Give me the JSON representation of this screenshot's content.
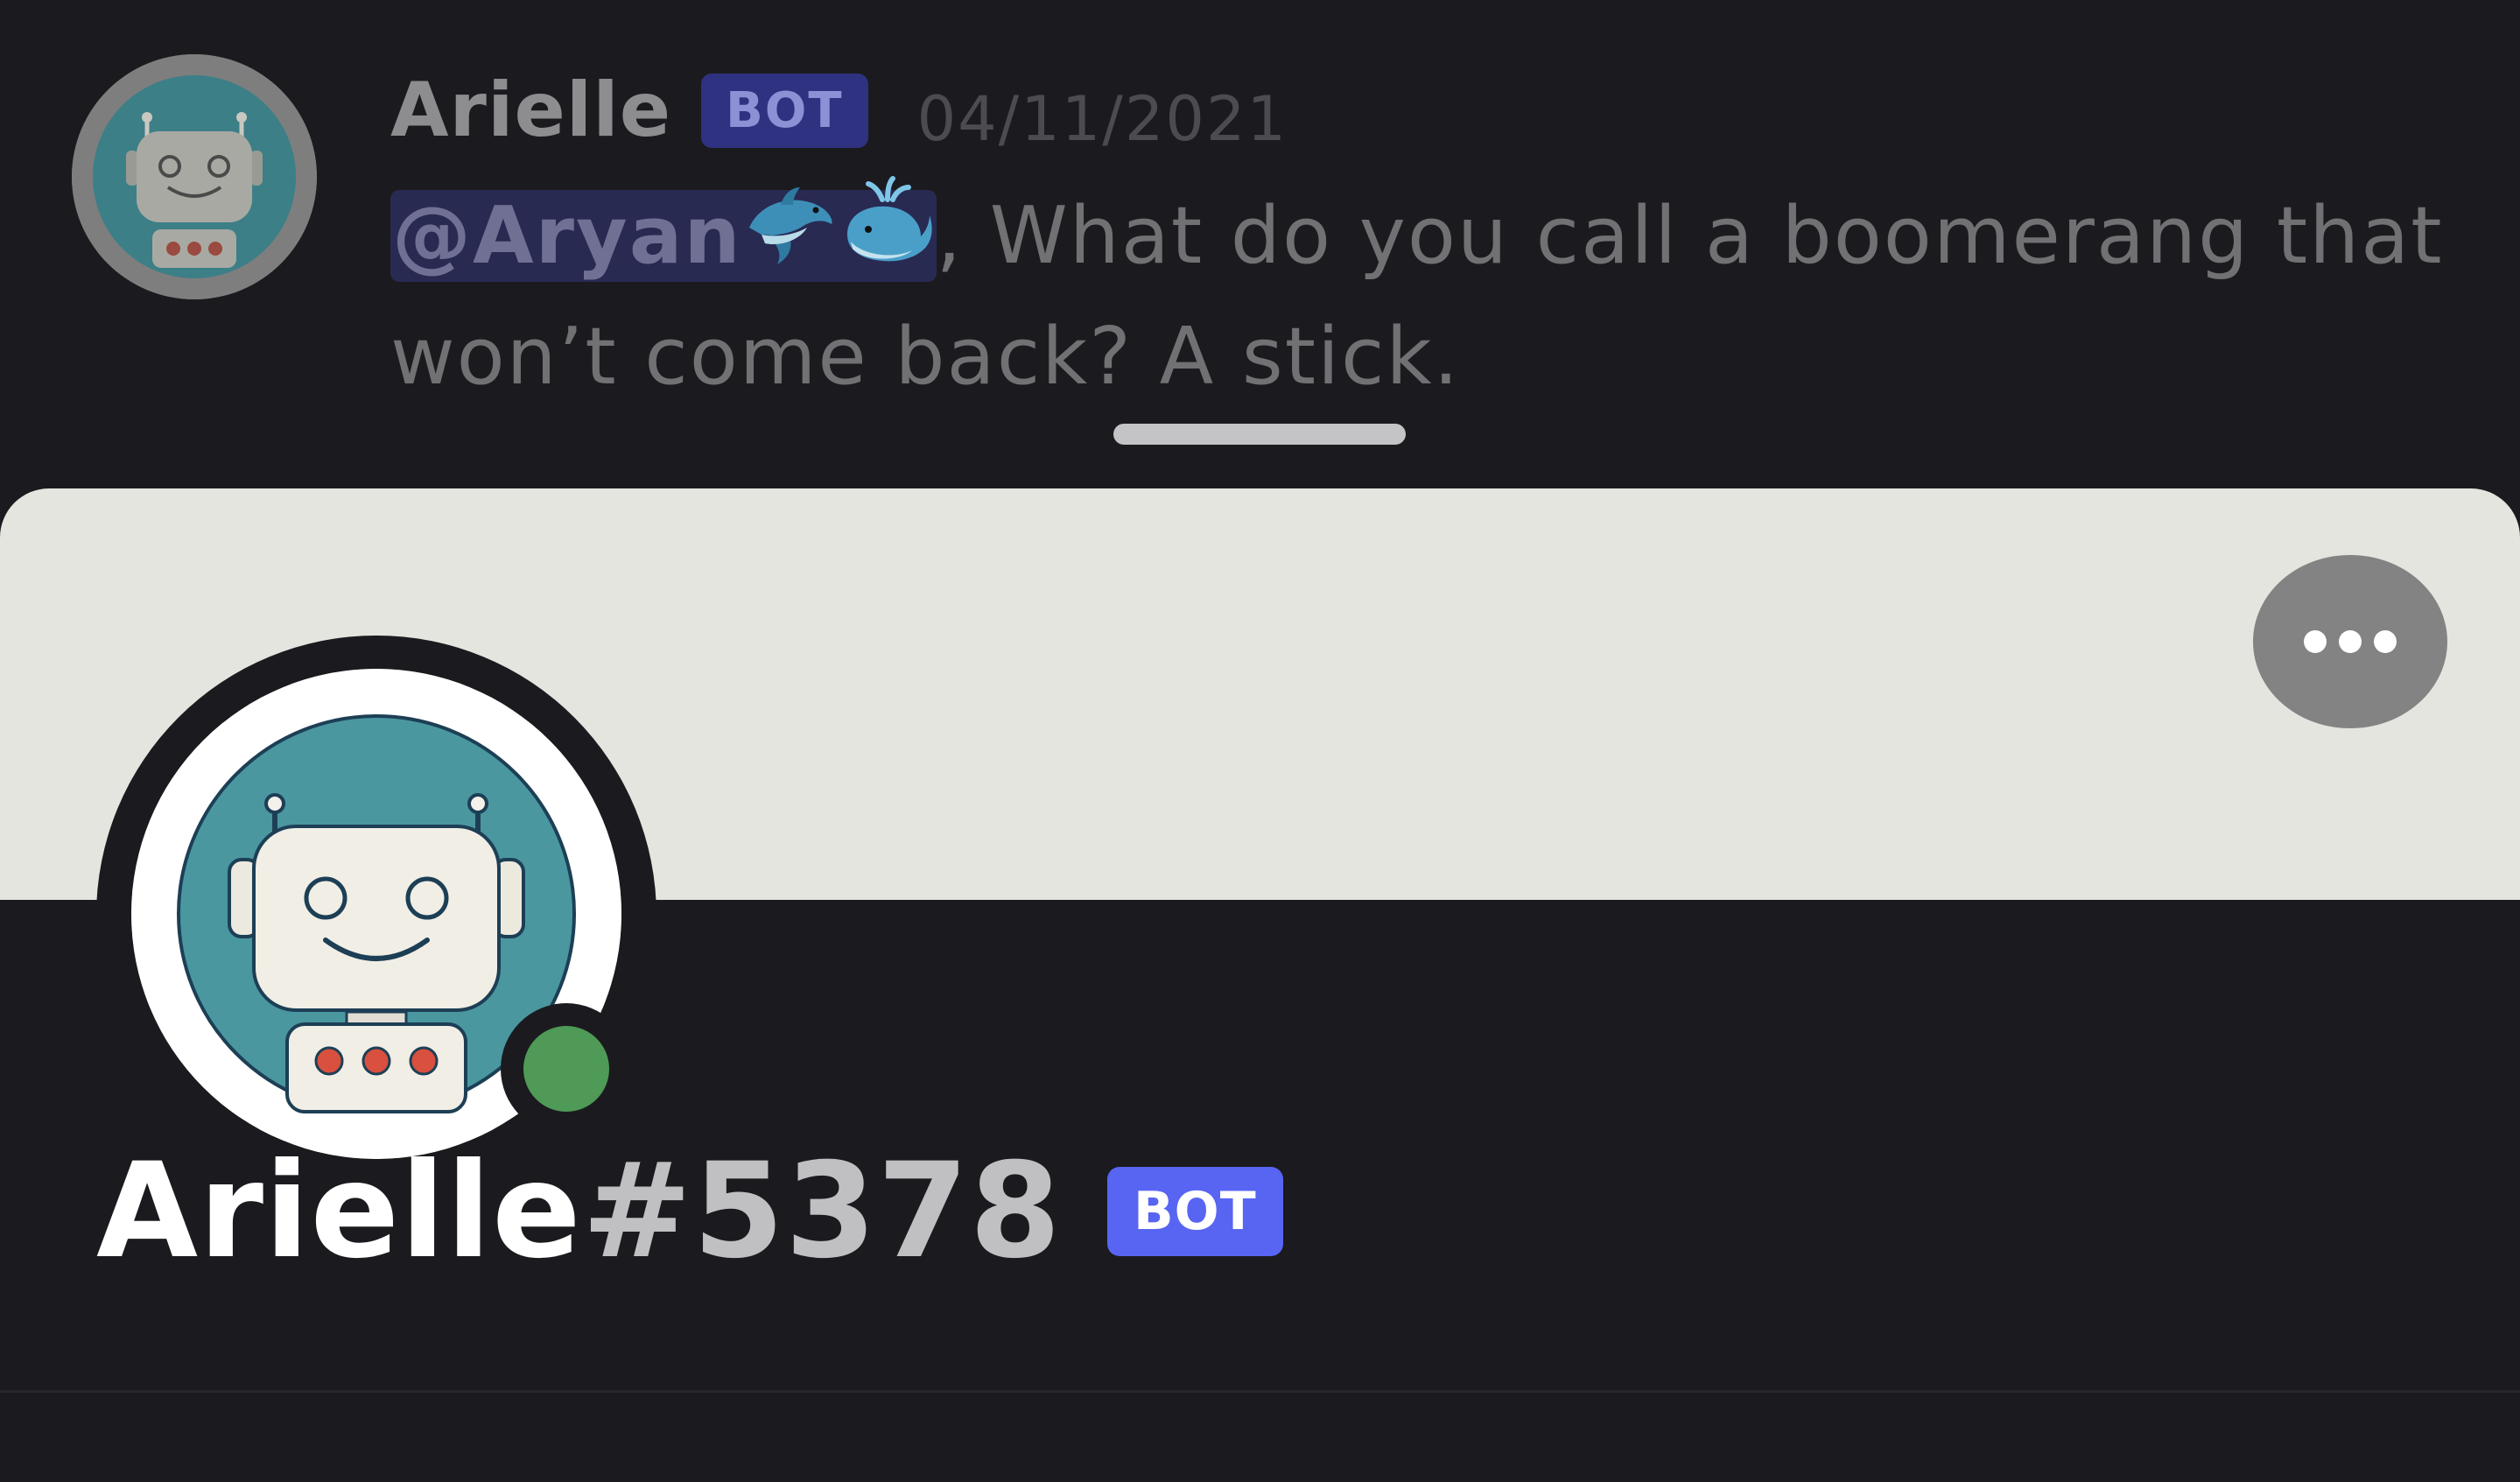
{
  "message": {
    "author": "Arielle",
    "bot_tag": "BOT",
    "timestamp": "04/11/2021",
    "mention": "@Aryan",
    "mention_emojis": [
      "dolphin-emoji",
      "spouting-whale-emoji"
    ],
    "text_after_mention": ", What do you call a boomerang that won’t come back? A stick."
  },
  "profile": {
    "username": "Arielle",
    "discriminator": "#5378",
    "bot_tag": "BOT",
    "status": "online",
    "more_icon": "ellipsis-icon"
  },
  "colors": {
    "background": "#1b1b1f",
    "banner": "#e4e5df",
    "bot_tag_bg": "#5865f2",
    "online_status": "#4e9a56",
    "avatar_teal": "#4a97a0"
  }
}
